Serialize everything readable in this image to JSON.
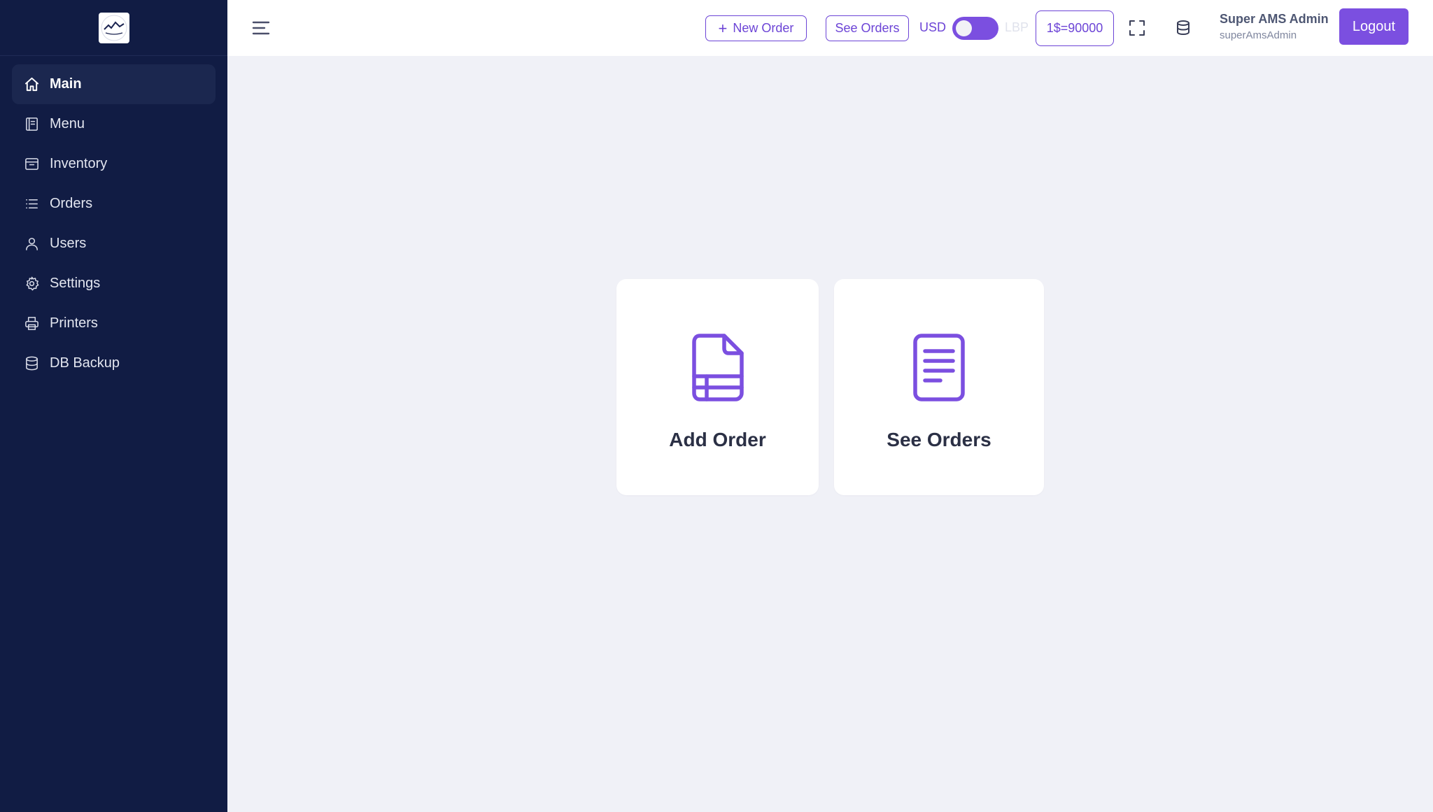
{
  "sidebar": {
    "logo_alt": "logo",
    "items": [
      {
        "label": "Main",
        "icon": "home-icon",
        "active": true
      },
      {
        "label": "Menu",
        "icon": "book-icon",
        "active": false
      },
      {
        "label": "Inventory",
        "icon": "archive-box-icon",
        "active": false
      },
      {
        "label": "Orders",
        "icon": "list-icon",
        "active": false
      },
      {
        "label": "Users",
        "icon": "user-icon",
        "active": false
      },
      {
        "label": "Settings",
        "icon": "gear-icon",
        "active": false
      },
      {
        "label": "Printers",
        "icon": "printer-icon",
        "active": false
      },
      {
        "label": "DB Backup",
        "icon": "database-icon",
        "active": false
      }
    ]
  },
  "topbar": {
    "new_order_label": "New Order",
    "see_orders_label": "See Orders",
    "currency_left": "USD",
    "currency_right": "LBP",
    "exchange_rate": "1$=90000",
    "user_name": "Super AMS Admin",
    "user_handle": "superAmsAdmin",
    "logout_label": "Logout"
  },
  "cards": {
    "add_order_title": "Add Order",
    "see_orders_title": "See Orders"
  },
  "colors": {
    "accent": "#7b4fe0",
    "sidebar_bg": "#111c44",
    "page_bg": "#f0f1f7"
  }
}
